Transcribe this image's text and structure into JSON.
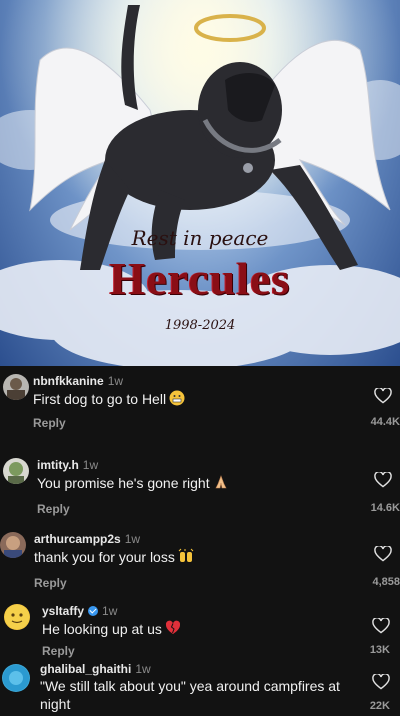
{
  "post": {
    "rip_text": "Rest in peace",
    "name_text": "Hercules",
    "years_text": "1998-2024"
  },
  "comments": [
    {
      "username": "nbnfkkanine",
      "time": "1w",
      "text": "First dog to go to Hell",
      "emoji": "grimace-emoji",
      "reply_label": "Reply",
      "likes": "44.4K"
    },
    {
      "username": "imtity.h",
      "time": "1w",
      "text": "You promise he's gone right",
      "emoji": "praying-hands-emoji",
      "reply_label": "Reply",
      "likes": "14.6K"
    },
    {
      "username": "arthurcampp2s",
      "time": "1w",
      "text": "thank you for your loss",
      "emoji": "raised-hands-emoji",
      "reply_label": "Reply",
      "likes": "4,858"
    },
    {
      "username": "ysltaffy",
      "time": "1w",
      "verified": true,
      "text": "He looking up at us",
      "emoji": "broken-heart-emoji",
      "reply_label": "Reply",
      "likes": "13K"
    },
    {
      "username": "ghalibal_ghaithi",
      "time": "1w",
      "text": "\"We still talk about you\" yea around campfires at night",
      "reply_label": "",
      "likes": "22K"
    }
  ]
}
